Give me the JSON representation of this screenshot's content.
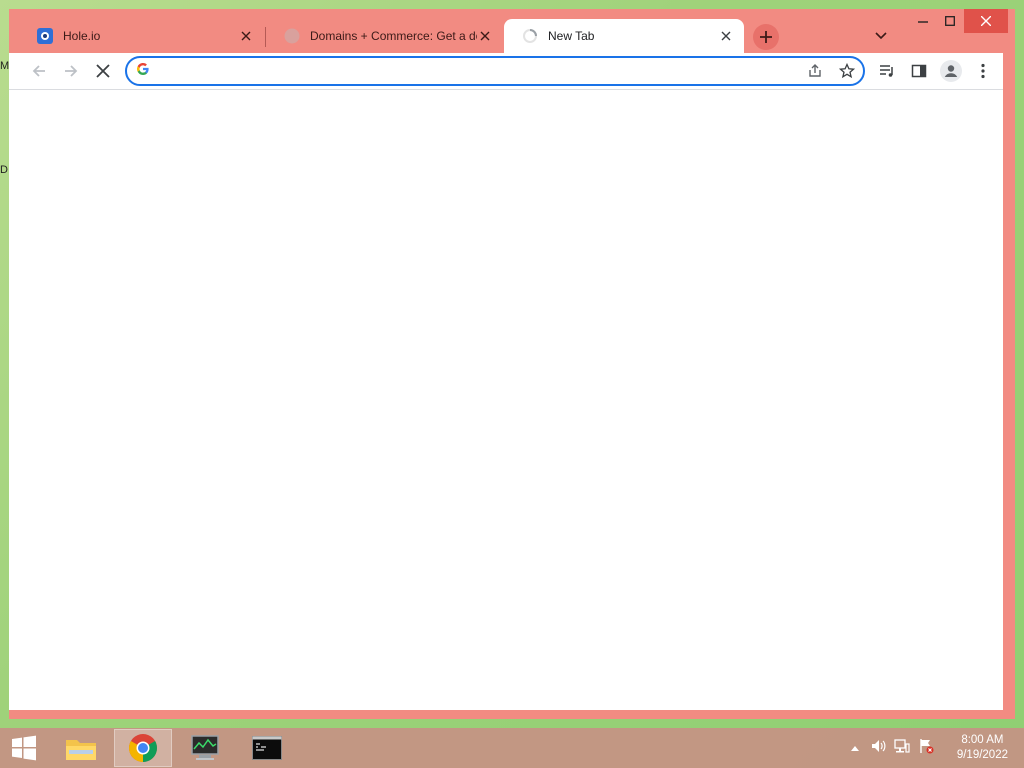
{
  "desktop": {
    "edge_glyph_1": "M",
    "edge_glyph_2": "D"
  },
  "browser": {
    "tabs": [
      {
        "title": "Hole.io",
        "icon": "hole-io-favicon",
        "active": false
      },
      {
        "title": "Domains + Commerce: Get a domain",
        "icon": "globe-favicon",
        "active": false
      },
      {
        "title": "New Tab",
        "icon": "loading-spinner",
        "active": true
      }
    ],
    "omnibox": {
      "value": "",
      "placeholder": ""
    },
    "colors": {
      "frame": "#f28b82",
      "accent": "#1a73e8"
    }
  },
  "taskbar": {
    "items": [
      {
        "name": "start",
        "icon": "windows-logo-icon"
      },
      {
        "name": "file-explorer",
        "icon": "folder-icon"
      },
      {
        "name": "chrome",
        "icon": "chrome-icon"
      },
      {
        "name": "task-manager",
        "icon": "monitor-icon"
      },
      {
        "name": "command-prompt",
        "icon": "cmd-icon"
      }
    ],
    "clock": {
      "time": "8:00 AM",
      "date": "9/19/2022"
    }
  }
}
